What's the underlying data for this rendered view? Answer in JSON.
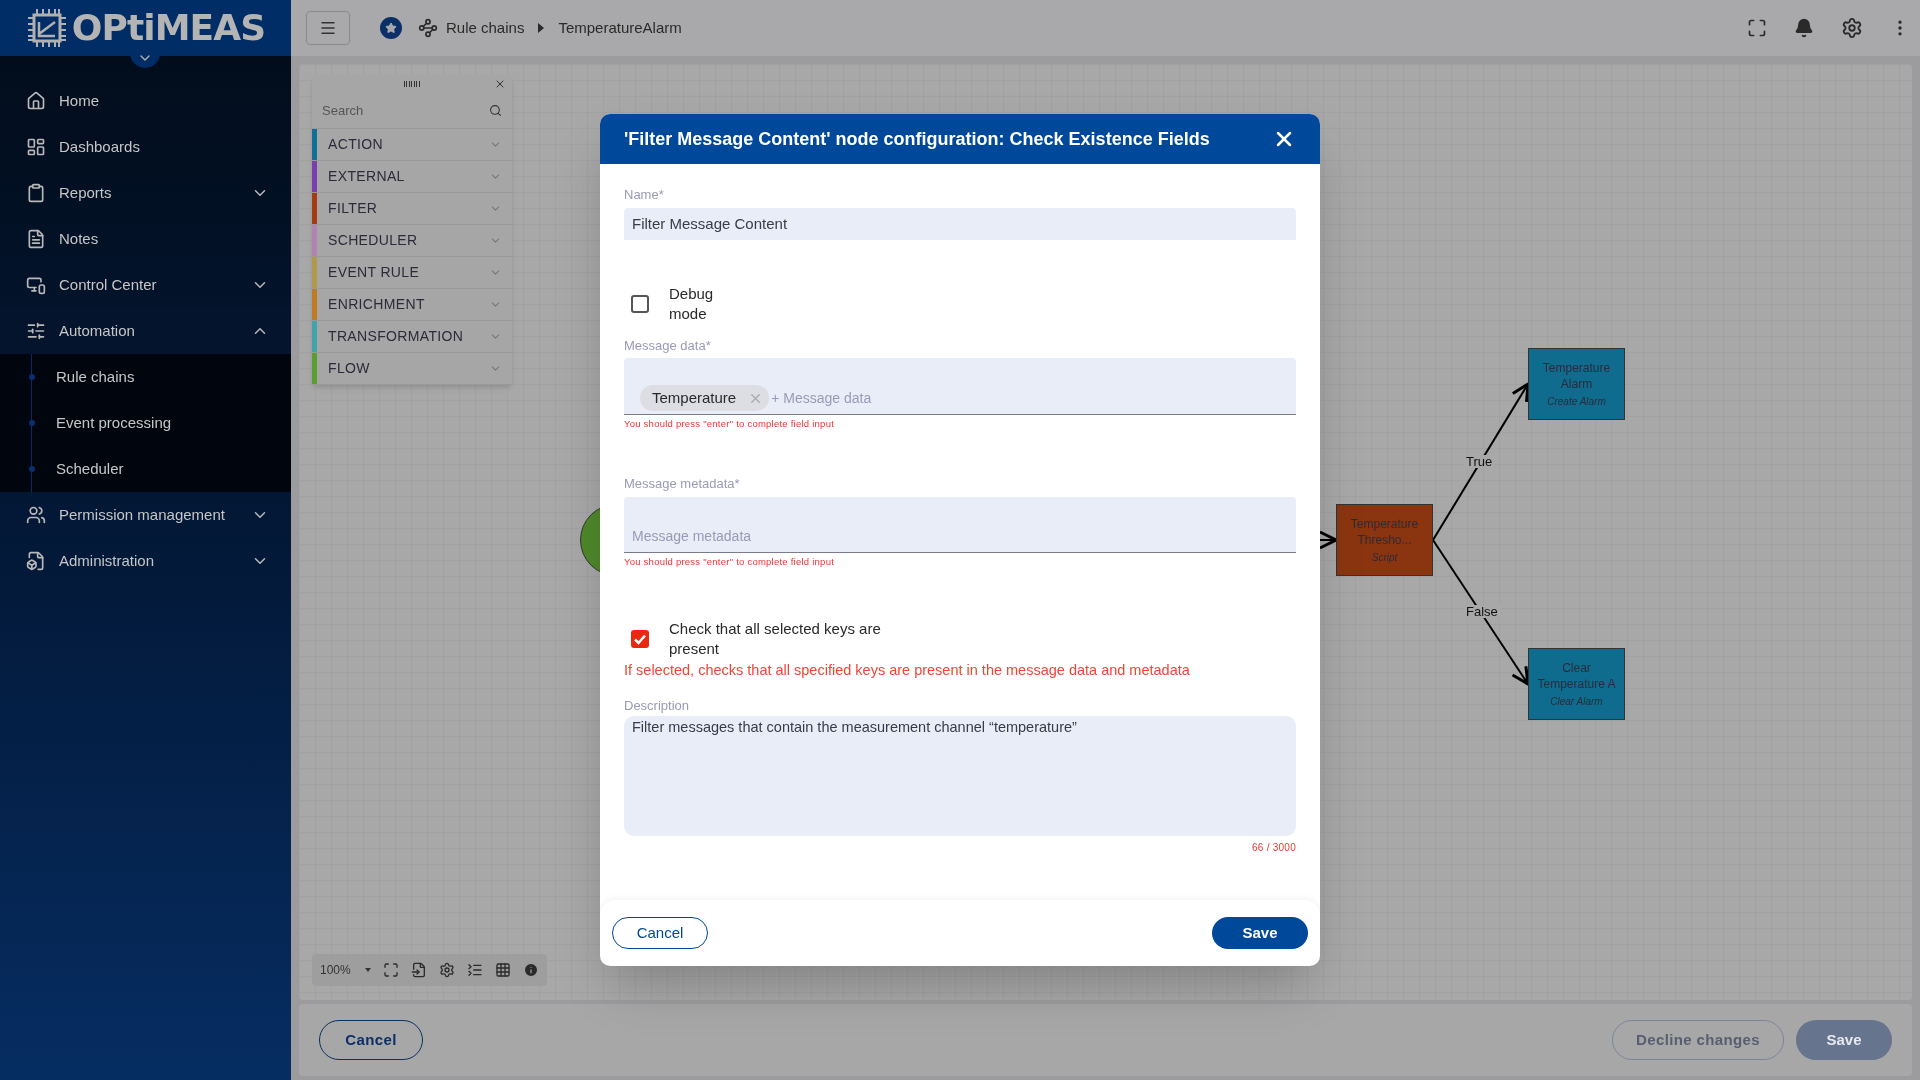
{
  "sidebar": {
    "logo": "OPtiMEAS",
    "items": [
      {
        "label": "Home",
        "kind": "link"
      },
      {
        "label": "Dashboards",
        "kind": "link"
      },
      {
        "label": "Reports",
        "kind": "group",
        "expanded": false
      },
      {
        "label": "Notes",
        "kind": "link"
      },
      {
        "label": "Control Center",
        "kind": "group",
        "expanded": false
      },
      {
        "label": "Automation",
        "kind": "group",
        "expanded": true,
        "children": [
          {
            "label": "Rule chains"
          },
          {
            "label": "Event processing"
          },
          {
            "label": "Scheduler"
          }
        ]
      },
      {
        "label": "Permission management",
        "kind": "group",
        "expanded": false
      },
      {
        "label": "Administration",
        "kind": "group",
        "expanded": false
      }
    ]
  },
  "topbar": {
    "breadcrumbs": [
      {
        "label": "Rule chains"
      },
      {
        "label": "TemperatureAlarm"
      }
    ]
  },
  "library": {
    "search_placeholder": "Search",
    "categories": [
      {
        "label": "ACTION",
        "color": "#0f6f96"
      },
      {
        "label": "EXTERNAL",
        "color": "#7a3fae"
      },
      {
        "label": "FILTER",
        "color": "#a63b12"
      },
      {
        "label": "SCHEDULER",
        "color": "#b183b5"
      },
      {
        "label": "EVENT RULE",
        "color": "#b09a48"
      },
      {
        "label": "ENRICHMENT",
        "color": "#c07a20"
      },
      {
        "label": "TRANSFORMATION",
        "color": "#41a3ab"
      },
      {
        "label": "FLOW",
        "color": "#5a9e30"
      }
    ]
  },
  "canvas": {
    "nodes": [
      {
        "kind": "input",
        "color": "#4f8a2a"
      },
      {
        "kind": "rule",
        "title": "Temperature Thresho...",
        "type": "Script",
        "color": "#8a3510"
      },
      {
        "kind": "rule",
        "title": "Temperature Alarm",
        "type": "Create Alarm",
        "color": "#0f6c8f"
      },
      {
        "kind": "rule",
        "title": "Clear Temperature A",
        "type": "Clear Alarm",
        "color": "#0f6c8f"
      }
    ],
    "edges": [
      {
        "label": "True"
      },
      {
        "label": "False"
      }
    ],
    "zoom": "100%"
  },
  "dialog": {
    "title": "'Filter Message Content' node configuration: Check Existence Fields",
    "name_label": "Name*",
    "name_value": "Filter Message Content",
    "debug": {
      "label": "Debug mode",
      "checked": false
    },
    "message_data": {
      "label": "Message data*",
      "chips": [
        {
          "label": "Temperature"
        }
      ],
      "placeholder": "+ Message data",
      "hint": "You should press \"enter\" to complete field input"
    },
    "message_metadata": {
      "label": "Message metadata*",
      "placeholder": "Message metadata",
      "hint": "You should press \"enter\" to complete field input"
    },
    "check_all": {
      "label": "Check that all selected keys are present",
      "checked": true,
      "hint": "If selected, checks that all specified keys are present in the message data and metadata"
    },
    "description": {
      "label": "Description",
      "value": "Filter messages that contain the measurement channel “temperature”",
      "counter": "66 / 3000"
    },
    "cancel": "Cancel",
    "save": "Save"
  },
  "bottom_bar": {
    "cancel": "Cancel",
    "decline": "Decline changes",
    "save": "Save"
  }
}
